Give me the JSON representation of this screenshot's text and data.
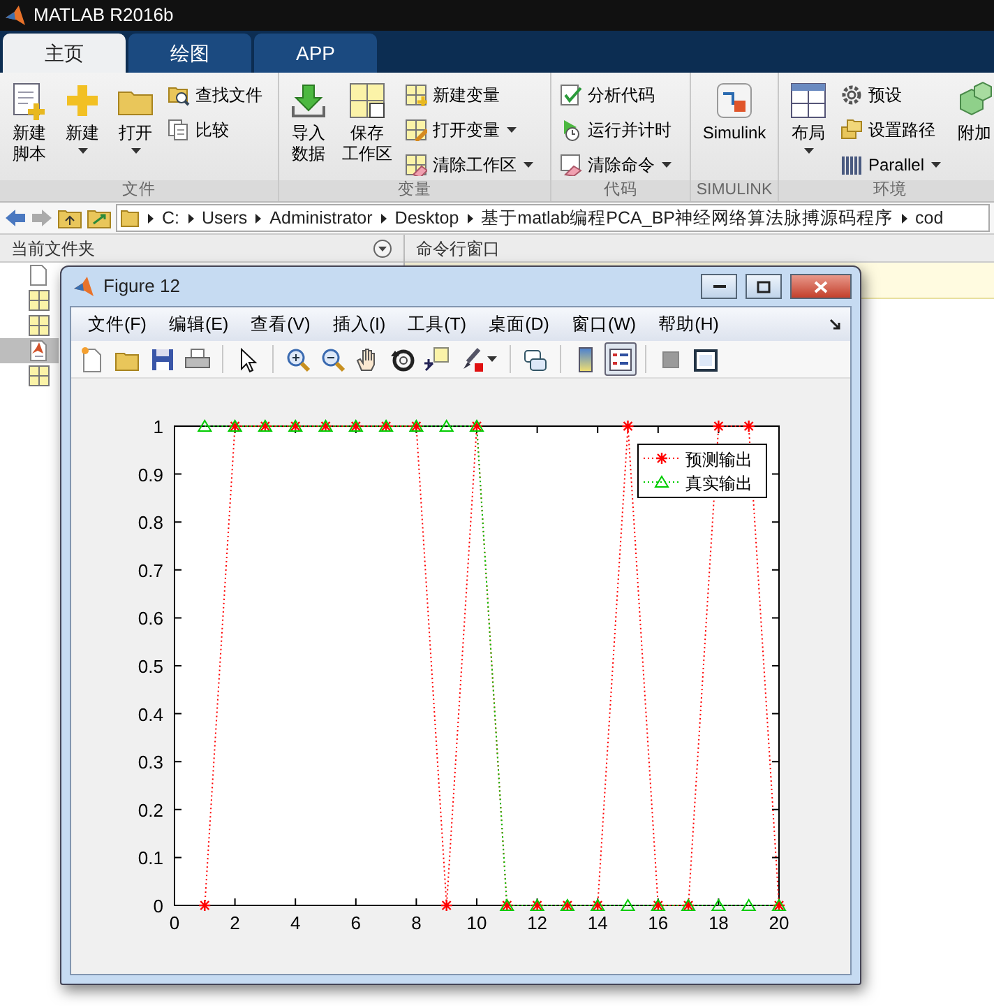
{
  "app": {
    "title": "MATLAB R2016b"
  },
  "tabs": [
    {
      "label": "主页",
      "selected": true
    },
    {
      "label": "绘图",
      "selected": false
    },
    {
      "label": "APP",
      "selected": false
    }
  ],
  "ribbon": [
    {
      "label": "文件",
      "columns": [
        [
          {
            "kind": "large",
            "lines": [
              "新建",
              "脚本"
            ],
            "dropdown": false
          }
        ],
        [
          {
            "kind": "large",
            "lines": [
              "新建"
            ],
            "dropdown": true
          }
        ],
        [
          {
            "kind": "large",
            "lines": [
              "打开"
            ],
            "dropdown": true
          }
        ],
        [
          {
            "kind": "small",
            "lines": [
              "查找文件"
            ],
            "dropdown": false
          },
          {
            "kind": "small",
            "lines": [
              "比较"
            ],
            "dropdown": false
          }
        ]
      ]
    },
    {
      "label": "变量",
      "columns": [
        [
          {
            "kind": "large",
            "lines": [
              "导入",
              "数据"
            ],
            "dropdown": false
          }
        ],
        [
          {
            "kind": "large",
            "lines": [
              "保存",
              "工作区"
            ],
            "dropdown": false
          }
        ],
        [
          {
            "kind": "small",
            "lines": [
              "新建变量"
            ],
            "dropdown": false
          },
          {
            "kind": "small",
            "lines": [
              "打开变量"
            ],
            "dropdown": true
          },
          {
            "kind": "small",
            "lines": [
              "清除工作区"
            ],
            "dropdown": true
          }
        ]
      ]
    },
    {
      "label": "代码",
      "columns": [
        [
          {
            "kind": "small",
            "lines": [
              "分析代码"
            ],
            "dropdown": false
          },
          {
            "kind": "small",
            "lines": [
              "运行并计时"
            ],
            "dropdown": false
          },
          {
            "kind": "small",
            "lines": [
              "清除命令"
            ],
            "dropdown": true
          }
        ]
      ]
    },
    {
      "label": "SIMULINK",
      "columns": [
        [
          {
            "kind": "large",
            "lines": [
              "Simulink"
            ],
            "dropdown": false
          }
        ]
      ]
    },
    {
      "label": "环境",
      "columns": [
        [
          {
            "kind": "large",
            "lines": [
              "布局"
            ],
            "dropdown": true
          }
        ],
        [
          {
            "kind": "small",
            "lines": [
              "预设"
            ],
            "dropdown": false
          },
          {
            "kind": "small",
            "lines": [
              "设置路径"
            ],
            "dropdown": false
          },
          {
            "kind": "small",
            "lines": [
              "Parallel"
            ],
            "dropdown": true
          }
        ],
        [
          {
            "kind": "large",
            "lines": [
              "附加"
            ],
            "dropdown": false
          }
        ]
      ]
    }
  ],
  "address": {
    "crumbs": [
      "C:",
      "Users",
      "Administrator",
      "Desktop",
      "基于matlab编程PCA_BP神经网络算法脉搏源码程序",
      "cod"
    ]
  },
  "current_folder": {
    "title": "当前文件夹",
    "files": [
      {
        "kind": "document",
        "selected": false
      },
      {
        "kind": "data",
        "selected": false
      },
      {
        "kind": "data",
        "selected": false
      },
      {
        "kind": "figure",
        "selected": true
      },
      {
        "kind": "data",
        "selected": false
      }
    ]
  },
  "command_window": {
    "title": "命令行窗口"
  },
  "figure": {
    "title": "Figure 12",
    "menu": [
      "文件(F)",
      "编辑(E)",
      "查看(V)",
      "插入(I)",
      "工具(T)",
      "桌面(D)",
      "窗口(W)",
      "帮助(H)"
    ],
    "toolbar": [
      [
        {
          "kind": "new",
          "pressed": false,
          "dropdown": false
        },
        {
          "kind": "open",
          "pressed": false,
          "dropdown": false
        },
        {
          "kind": "save",
          "pressed": false,
          "dropdown": false
        },
        {
          "kind": "print",
          "pressed": false,
          "dropdown": false
        }
      ],
      [
        {
          "kind": "pointer",
          "pressed": false,
          "dropdown": false
        }
      ],
      [
        {
          "kind": "zoom-in",
          "pressed": false,
          "dropdown": false
        },
        {
          "kind": "zoom-out",
          "pressed": false,
          "dropdown": false
        },
        {
          "kind": "pan",
          "pressed": false,
          "dropdown": false
        },
        {
          "kind": "rotate",
          "pressed": false,
          "dropdown": false
        },
        {
          "kind": "data-cursor",
          "pressed": false,
          "dropdown": false
        },
        {
          "kind": "brush",
          "pressed": false,
          "dropdown": true
        }
      ],
      [
        {
          "kind": "link",
          "pressed": false,
          "dropdown": false
        }
      ],
      [
        {
          "kind": "colorbar",
          "pressed": false,
          "dropdown": false
        },
        {
          "kind": "legend",
          "pressed": true,
          "dropdown": false
        }
      ],
      [
        {
          "kind": "square",
          "pressed": false,
          "dropdown": false
        },
        {
          "kind": "panel",
          "pressed": false,
          "dropdown": false
        }
      ]
    ],
    "chart_data": {
      "type": "line",
      "x": [
        1,
        2,
        3,
        4,
        5,
        6,
        7,
        8,
        9,
        10,
        11,
        12,
        13,
        14,
        15,
        16,
        17,
        18,
        19,
        20
      ],
      "series": [
        {
          "name": "预测输出",
          "color": "#ff0000",
          "line_style": "dotted",
          "marker": "cross",
          "values": [
            0,
            1,
            1,
            1,
            1,
            1,
            1,
            1,
            0,
            1,
            0,
            0,
            0,
            0,
            1,
            0,
            0,
            1,
            1,
            0
          ]
        },
        {
          "name": "真实输出",
          "color": "#00cc00",
          "line_style": "dotted",
          "marker": "triangle",
          "values": [
            1,
            1,
            1,
            1,
            1,
            1,
            1,
            1,
            1,
            1,
            0,
            0,
            0,
            0,
            0,
            0,
            0,
            0,
            0,
            0
          ]
        }
      ],
      "legend": true,
      "xlim": [
        0,
        20
      ],
      "ylim": [
        0,
        1
      ],
      "xticks": [
        0,
        2,
        4,
        6,
        8,
        10,
        12,
        14,
        16,
        18,
        20
      ],
      "yticks": [
        0,
        0.1,
        0.2,
        0.3,
        0.4,
        0.5,
        0.6,
        0.7,
        0.8,
        0.9,
        1
      ]
    }
  }
}
